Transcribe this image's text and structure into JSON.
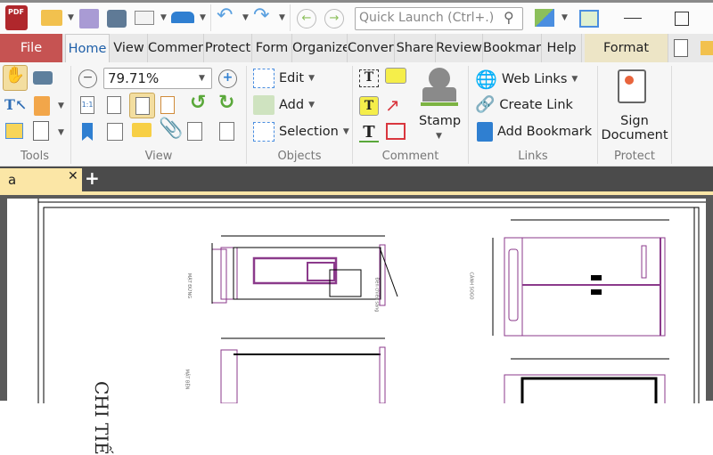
{
  "app": {
    "logo_text": "PDF"
  },
  "quick_launch": {
    "placeholder": "Quick Launch (Ctrl+.)"
  },
  "menu_tabs": [
    {
      "label": "File"
    },
    {
      "label": "Home"
    },
    {
      "label": "View"
    },
    {
      "label": "Commen"
    },
    {
      "label": "Protect"
    },
    {
      "label": "Form"
    },
    {
      "label": "Organize"
    },
    {
      "label": "Convert"
    },
    {
      "label": "Share"
    },
    {
      "label": "Review"
    },
    {
      "label": "Bookmark"
    },
    {
      "label": "Help"
    },
    {
      "label": "Format"
    }
  ],
  "ribbon": {
    "zoom_value": "79.71%",
    "objects": {
      "edit": "Edit",
      "add": "Add",
      "selection": "Selection"
    },
    "comment": {
      "stamp": "Stamp"
    },
    "links": {
      "web_links": "Web Links",
      "create_link": "Create Link",
      "add_bookmark": "Add Bookmark"
    },
    "protect": {
      "sign_line1": "Sign",
      "sign_line2": "Document"
    },
    "groups": {
      "tools": "Tools",
      "view": "View",
      "objects": "Objects",
      "comment": "Comment",
      "links": "Links",
      "protect": "Protect"
    }
  },
  "doc_tabs": [
    {
      "label": "a"
    }
  ],
  "document": {
    "big_title": "CHI TIẾ",
    "label_front": "MẶT ĐỨNG",
    "label_side": "MẶT BÊN",
    "label_lamp": "Đèn chiếu sáng",
    "label_right": "CÁNH SOGO"
  },
  "colors": {
    "file_tab": "#c65352",
    "format_tab": "#ede5c6",
    "drawing": "#8b3a8b"
  }
}
